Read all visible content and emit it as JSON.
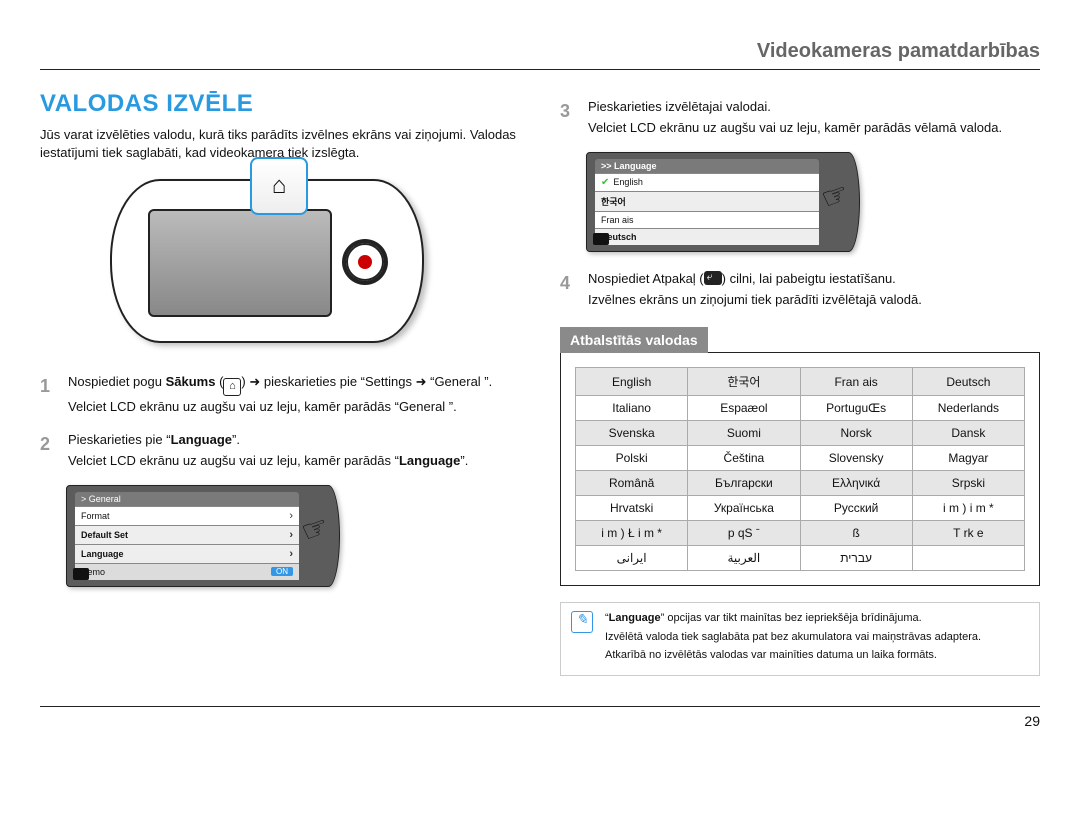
{
  "breadcrumb": "Videokameras pamatdarbības",
  "title": "VALODAS IZVĒLE",
  "intro": "Jūs varat izvēlēties valodu, kurā tiks parādīts izvēlnes ekrāns vai ziņojumi. Valodas iestatījumi tiek saglabāti, kad videokamera tiek izslēgta.",
  "steps": {
    "1": {
      "num": "1",
      "a_pre": "Nospiediet pogu ",
      "a_bold": "Sākums",
      "a_post": " (",
      "a_post2": ") ➜ pieskarieties pie “Settings",
      "a_post3": "➜ “General ”.",
      "b": "Velciet LCD ekrānu uz augšu vai uz leju, kamēr parādās “General ”."
    },
    "2": {
      "num": "2",
      "a_pre": "Pieskarieties pie “",
      "a_bold": "Language",
      "a_post": "”.",
      "b_pre": "Velciet LCD ekrānu uz augšu vai uz leju, kamēr parādās “",
      "b_bold": "Language",
      "b_post": "”."
    },
    "3": {
      "num": "3",
      "a": "Pieskarieties izvēlētajai valodai.",
      "b": "Velciet LCD ekrānu uz augšu vai uz leju, kamēr parādās vēlamā valoda."
    },
    "4": {
      "num": "4",
      "a_pre": "Nospiediet Atpakaļ (",
      "a_post": ") cilni, lai pabeigtu iestatīšanu.",
      "b": "Izvēlnes ekrāns un ziņojumi tiek parādīti izvēlētajā valodā."
    }
  },
  "lcd1": {
    "head": ">  General",
    "r1": "Format",
    "r2": "Default Set",
    "r3": "Language",
    "r4": "Demo",
    "on": "ON"
  },
  "lcd2": {
    "head": ">> Language",
    "r1": "English",
    "r2": "한국어",
    "r3": "Fran ais",
    "r4": "Deutsch"
  },
  "supported_head": "Atbalstītās valodas",
  "languages": {
    "r1": [
      "English",
      "한국어",
      "Fran ais",
      "Deutsch"
    ],
    "r2": [
      "Italiano",
      "Espaæol",
      "PortuguŒs",
      "Nederlands"
    ],
    "r3": [
      "Svenska",
      "Suomi",
      "Norsk",
      "Dansk"
    ],
    "r4": [
      "Polski",
      "Čeština",
      "Slovensky",
      "Magyar"
    ],
    "r5": [
      "Română",
      "Български",
      "Ελληνικά",
      "Srpski"
    ],
    "r6": [
      "Hrvatski",
      "Українська",
      "Русский",
      "i m )    i m    *"
    ],
    "r7": [
      "i m ) Ł   i m   *",
      "p qS ˉ",
      "ß",
      "T rk e"
    ],
    "r8": [
      "ﺍﻳﺮﺍﻧﯽ",
      "ﺍﻟﻌﺮﺑﻴﺔ",
      "עברית",
      ""
    ]
  },
  "notes": {
    "n1_pre": "“",
    "n1_bold": "Language",
    "n1_post": "” opcijas var tikt mainītas bez iepriekšēja brīdinājuma.",
    "n2": "Izvēlētā valoda tiek saglabāta pat bez akumulatora vai maiņstrāvas adaptera.",
    "n3": "Atkarībā no izvēlētās valodas var mainīties datuma un laika formāts."
  },
  "page_number": "29"
}
